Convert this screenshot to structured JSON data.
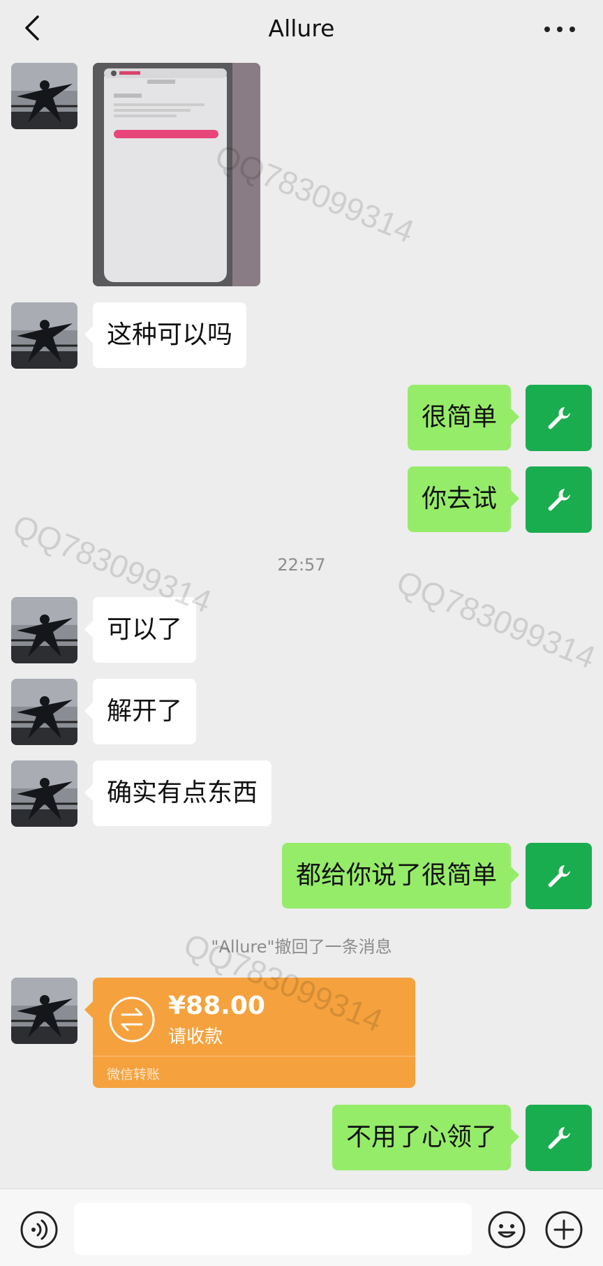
{
  "header": {
    "title": "Allure"
  },
  "messages": {
    "m2": "这种可以吗",
    "m3": "很简单",
    "m4": "你去试",
    "time": "22:57",
    "m5": "可以了",
    "m6": "解开了",
    "m7": "确实有点东西",
    "m8": "都给你说了很简单",
    "recall": "\"Allure\"撤回了一条消息",
    "m9": "不用了心领了"
  },
  "transfer": {
    "amount": "¥88.00",
    "note": "请收款",
    "footer": "微信转账"
  },
  "input": {
    "placeholder": ""
  },
  "watermark": "QQ783099314",
  "colors": {
    "background": "#ededed",
    "outgoing_bubble": "#95ec69",
    "incoming_bubble": "#ffffff",
    "transfer": "#f5a23e",
    "self_avatar": "#1aad4f"
  },
  "icons": {
    "back": "chevron-left-icon",
    "more": "ellipsis-icon",
    "self_avatar": "wrench-icon",
    "transfer": "exchange-arrows-icon",
    "voice": "voice-icon",
    "emoji": "smiley-icon",
    "plus": "plus-icon"
  }
}
